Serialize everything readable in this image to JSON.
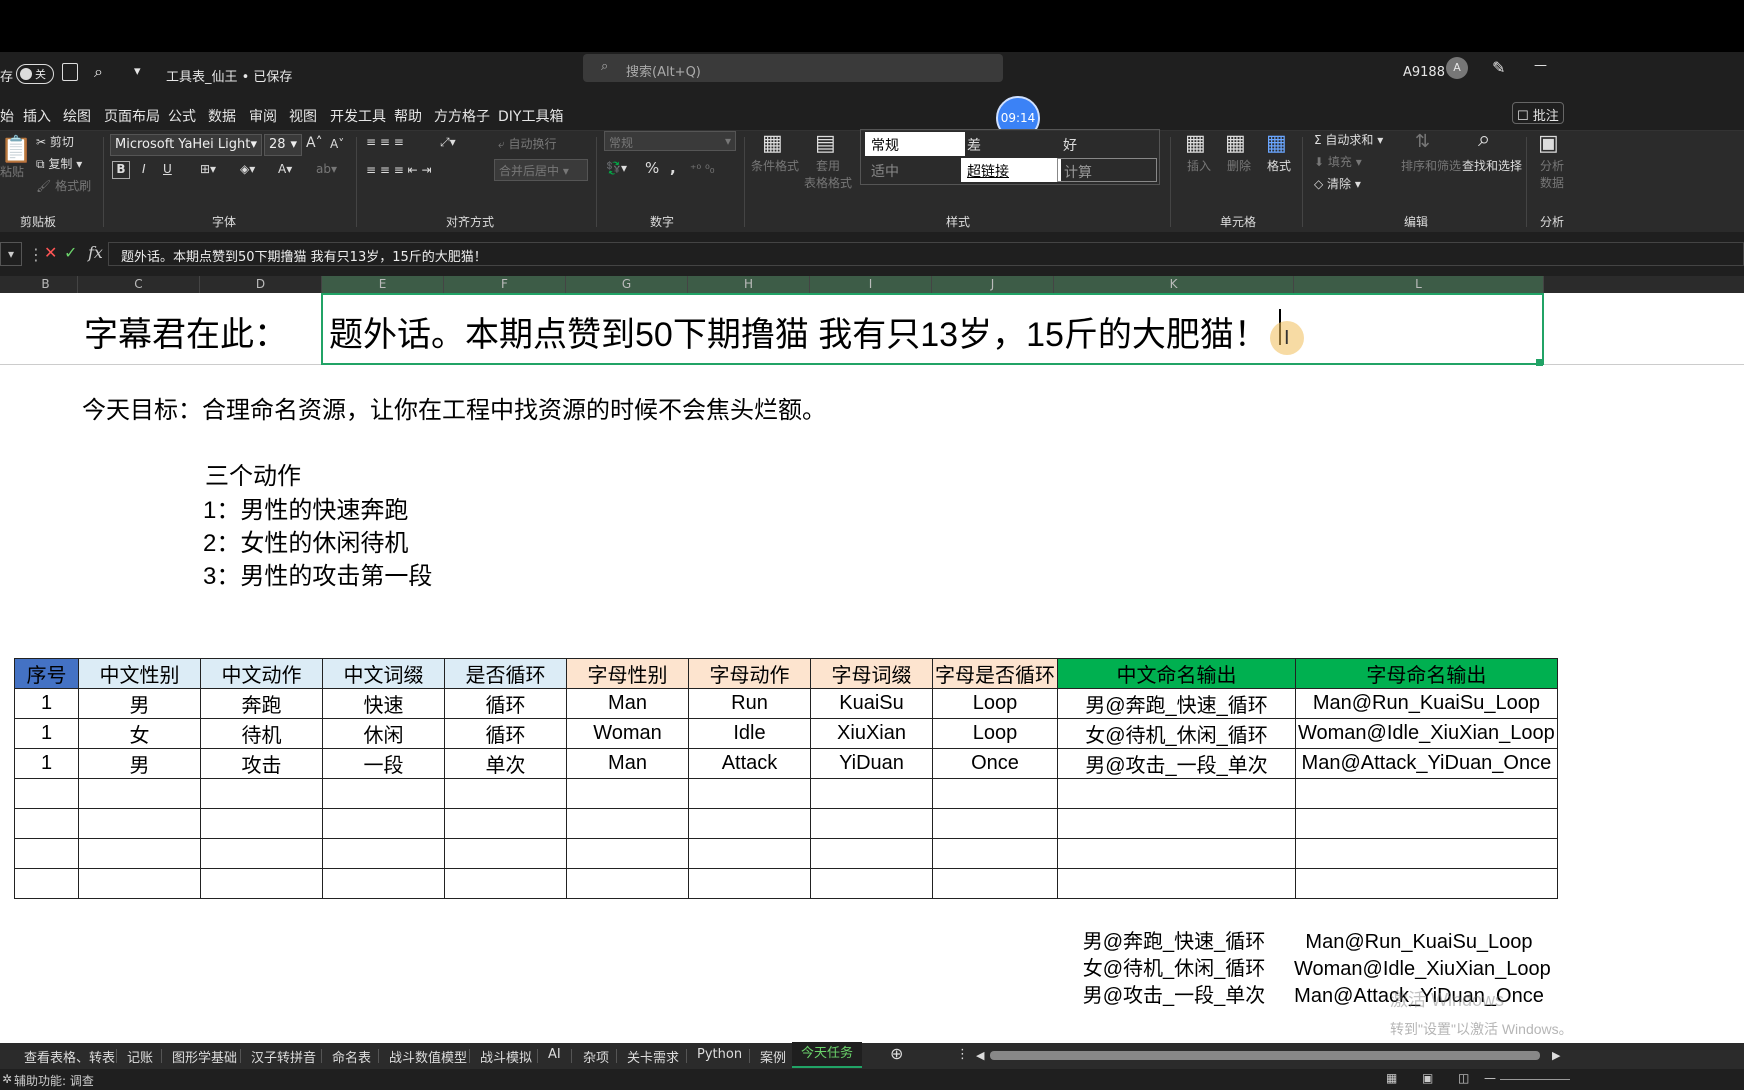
{
  "title": {
    "autosave_label": "存",
    "autosave_toggle": "关",
    "filename": "工具表_仙王 • 已保存",
    "search_placeholder": "搜索(Alt+Q)",
    "user": "A9188",
    "avatar": "A",
    "minimize": "—"
  },
  "menu": [
    "始",
    "插入",
    "绘图",
    "页面布局",
    "公式",
    "数据",
    "审阅",
    "视图",
    "开发工具",
    "帮助",
    "方方格子",
    "DIY工具箱"
  ],
  "menu_comment": "批注",
  "timer": "09:14",
  "ribbon": {
    "clipboard": {
      "paste": "粘贴",
      "cut": "剪切",
      "copy": "复制",
      "format_painter": "格式刷",
      "group": "剪贴板"
    },
    "font": {
      "name": "Microsoft YaHei Light",
      "size": "28",
      "bold": "B",
      "italic": "I",
      "underline": "U",
      "group": "字体"
    },
    "align": {
      "wrap": "自动换行",
      "merge": "合并后居中",
      "group": "对齐方式"
    },
    "number": {
      "format": "常规",
      "percent": "%",
      "comma": ",",
      "group": "数字"
    },
    "styles": {
      "conditional": "条件格式",
      "table": "套用\n表格格式",
      "cells": [
        "常规",
        "差",
        "好",
        "适中",
        "超链接",
        "计算"
      ],
      "group": "样式"
    },
    "cells": {
      "insert": "插入",
      "delete": "删除",
      "format": "格式",
      "group": "单元格"
    },
    "edit": {
      "autosum": "自动求和",
      "fill": "填充",
      "clear": "清除",
      "sort": "排序和筛选",
      "find": "查找和选择",
      "group": "编辑"
    },
    "analysis": {
      "label": "分析\n数据",
      "group": "分析"
    }
  },
  "formula_bar": {
    "content": "题外话。本期点赞到50下期撸猫 我有只13岁，15斤的大肥猫！"
  },
  "columns": [
    "B",
    "C",
    "D",
    "E",
    "F",
    "G",
    "H",
    "I",
    "J",
    "K",
    "L"
  ],
  "sheet": {
    "caption": "字幕君在此：",
    "aside": "题外话。本期点赞到50下期撸猫  我有只13岁，15斤的大肥猫！",
    "goal": "今天目标：合理命名资源，让你在工程中找资源的时候不会焦头烂额。",
    "actions_title": "三个动作",
    "actions": [
      "1：男性的快速奔跑",
      "2：女性的休闲待机",
      "3：男性的攻击第一段"
    ],
    "table_header": [
      "序号",
      "中文性别",
      "中文动作",
      "中文词缀",
      "是否循环",
      "字母性别",
      "字母动作",
      "字母词缀",
      "字母是否循环",
      "中文命名输出",
      "字母命名输出"
    ],
    "rows": [
      [
        "1",
        "男",
        "奔跑",
        "快速",
        "循环",
        "Man",
        "Run",
        "KuaiSu",
        "Loop",
        "男@奔跑_快速_循环",
        "Man@Run_KuaiSu_Loop"
      ],
      [
        "1",
        "女",
        "待机",
        "休闲",
        "循环",
        "Woman",
        "Idle",
        "XiuXian",
        "Loop",
        "女@待机_休闲_循环",
        "Woman@Idle_XiuXian_Loop"
      ],
      [
        "1",
        "男",
        "攻击",
        "一段",
        "单次",
        "Man",
        "Attack",
        "YiDuan",
        "Once",
        "男@攻击_一段_单次",
        "Man@Attack_YiDuan_Once"
      ]
    ],
    "output_cn": [
      "男@奔跑_快速_循环",
      "女@待机_休闲_循环",
      "男@攻击_一段_单次"
    ],
    "output_en": [
      "Man@Run_KuaiSu_Loop",
      "Woman@Idle_XiuXian_Loop",
      "Man@Attack_YiDuan_Once"
    ],
    "watermark1": "激活 Windows",
    "watermark2": "转到\"设置\"以激活 Windows。"
  },
  "tabs": [
    "查看表格、转表",
    "记账",
    "图形学基础",
    "汉子转拼音",
    "命名表",
    "战斗数值模型",
    "战斗模拟",
    "AI",
    "杂项",
    "关卡需求",
    "Python",
    "案例",
    "今天任务"
  ],
  "active_tab": "今天任务",
  "status": {
    "text": "辅助功能: 调查"
  },
  "colors": {
    "accent": "#21a366",
    "header_blue": "#4472c4",
    "header_green": "#00b050"
  }
}
